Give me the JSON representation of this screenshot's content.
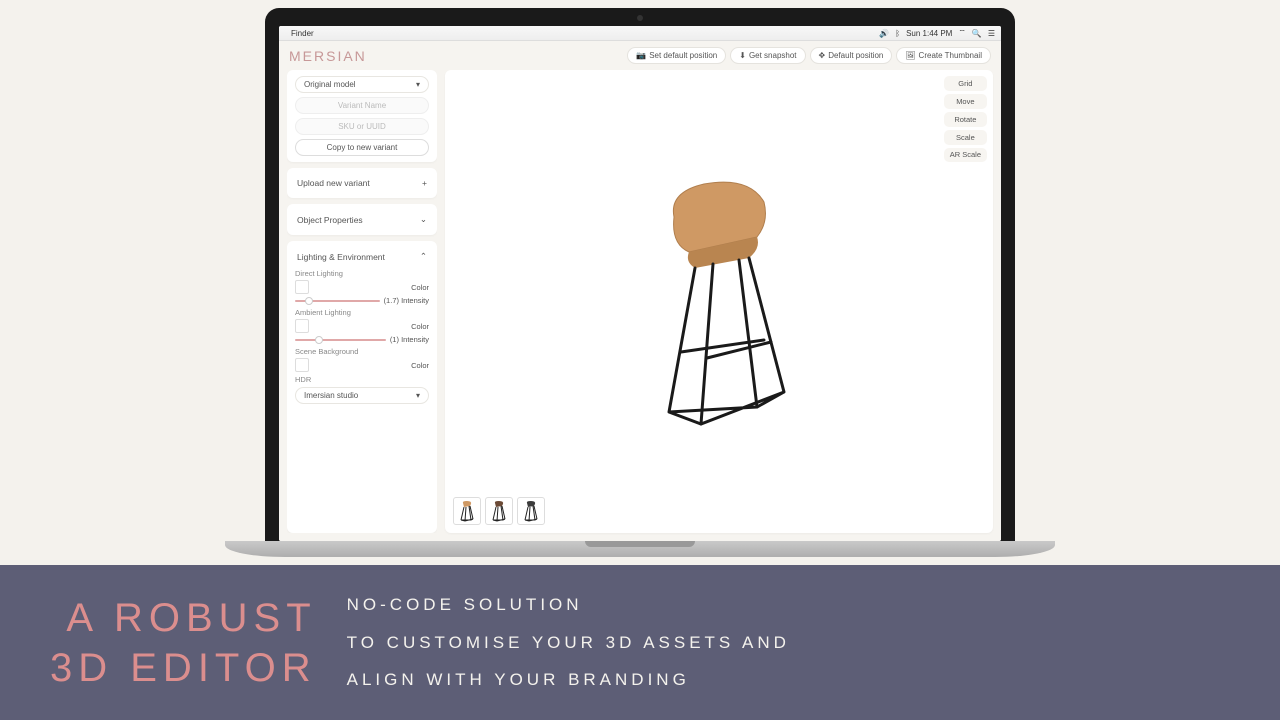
{
  "menubar": {
    "app": "Finder",
    "time": "Sun 1:44 PM"
  },
  "logo": "MERSIAN",
  "topActions": {
    "setDefault": "Set default position",
    "snapshot": "Get snapshot",
    "defaultPos": "Default position",
    "thumbnail": "Create Thumbnail"
  },
  "sidebar": {
    "modelSelect": "Original model",
    "variantNamePh": "Variant Name",
    "skuPh": "SKU or UUID",
    "copyBtn": "Copy to new variant",
    "uploadRow": "Upload new variant",
    "objProps": "Object Properties",
    "lightingEnv": "Lighting & Environment",
    "directLighting": "Direct Lighting",
    "ambientLighting": "Ambient Lighting",
    "sceneBg": "Scene Background",
    "hdr": "HDR",
    "colorLbl": "Color",
    "directIntensity": "(1.7) Intensity",
    "ambientIntensity": "(1) Intensity",
    "hdrSelect": "Imersian studio"
  },
  "tools": {
    "grid": "Grid",
    "move": "Move",
    "rotate": "Rotate",
    "scale": "Scale",
    "arscale": "AR Scale"
  },
  "banner": {
    "headline1": "A ROBUST",
    "headline2": "3D EDITOR",
    "line1": "NO-CODE SOLUTION",
    "line2": "TO CUSTOMISE YOUR 3D ASSETS AND",
    "line3": "ALIGN WITH YOUR BRANDING"
  },
  "thumbColors": [
    "#cf9964",
    "#6b4a36",
    "#3b3b3b"
  ]
}
